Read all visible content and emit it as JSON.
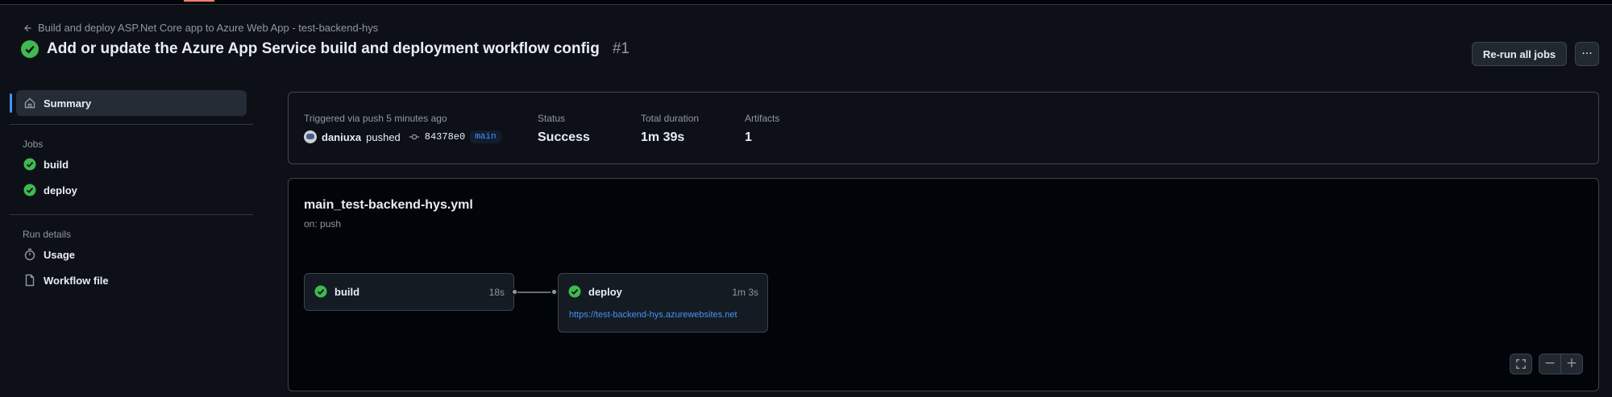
{
  "header": {
    "back_label": "Build and deploy ASP.Net Core app to Azure Web App - test-backend-hys",
    "run_title": "Add or update the Azure App Service build and deployment workflow config",
    "run_number": "#1",
    "rerun_label": "Re-run all jobs",
    "more_label": "···"
  },
  "sidebar": {
    "summary_label": "Summary",
    "jobs_heading": "Jobs",
    "jobs": [
      {
        "label": "build"
      },
      {
        "label": "deploy"
      }
    ],
    "run_details_heading": "Run details",
    "run_details": [
      {
        "label": "Usage",
        "icon": "stopwatch-icon"
      },
      {
        "label": "Workflow file",
        "icon": "file-icon"
      }
    ]
  },
  "summary": {
    "trigger_label": "Triggered via push 5 minutes ago",
    "actor": "daniuxa",
    "action": "pushed",
    "commit_sha": "84378e0",
    "branch": "main",
    "status_label": "Status",
    "status_value": "Success",
    "duration_label": "Total duration",
    "duration_value": "1m 39s",
    "artifacts_label": "Artifacts",
    "artifacts_value": "1"
  },
  "workflow": {
    "file_name": "main_test-backend-hys.yml",
    "trigger": "on: push",
    "jobs": [
      {
        "name": "build",
        "duration": "18s",
        "status": "success"
      },
      {
        "name": "deploy",
        "duration": "1m 3s",
        "status": "success",
        "url": "https://test-backend-hys.azurewebsites.net"
      }
    ],
    "zoom_controls": {
      "fullscreen": "⛶",
      "zoom_out": "−",
      "zoom_in": "+"
    }
  },
  "colors": {
    "success": "#3fb950",
    "accent": "#4493f8",
    "background": "#0d1117"
  }
}
